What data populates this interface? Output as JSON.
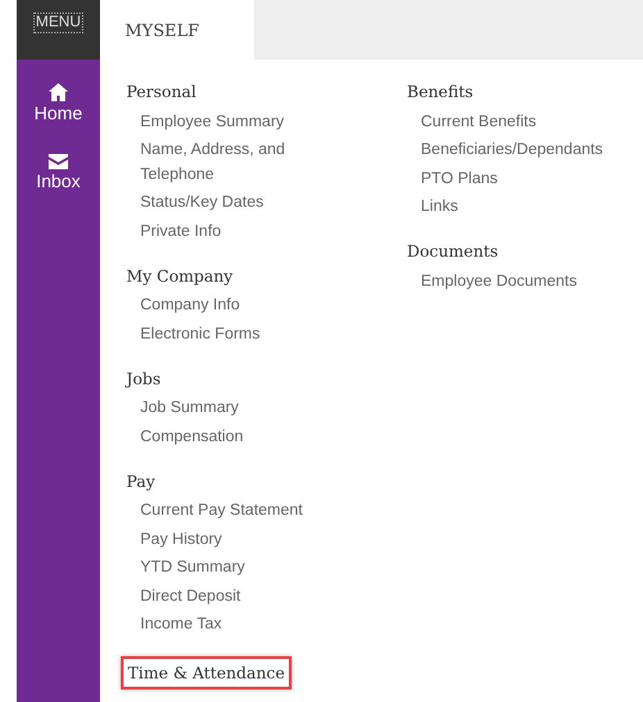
{
  "sidebar": {
    "menu_label": "MENU",
    "items": [
      {
        "label": "Home",
        "kind": "home"
      },
      {
        "label": "Inbox",
        "kind": "inbox"
      }
    ]
  },
  "tabs": [
    {
      "label": "MYSELF",
      "selected": true
    }
  ],
  "columns": [
    [
      {
        "title": "Personal",
        "highlighted": false,
        "items": [
          "Employee Summary",
          "Name, Address, and Telephone",
          "Status/Key Dates",
          "Private Info"
        ]
      },
      {
        "title": "My Company",
        "highlighted": false,
        "items": [
          "Company Info",
          "Electronic Forms"
        ]
      },
      {
        "title": "Jobs",
        "highlighted": false,
        "items": [
          "Job Summary",
          "Compensation"
        ]
      },
      {
        "title": "Pay",
        "highlighted": false,
        "items": [
          "Current Pay Statement",
          "Pay History",
          "YTD Summary",
          "Direct Deposit",
          "Income Tax"
        ]
      },
      {
        "title": "Time & Attendance",
        "highlighted": true
      }
    ],
    [
      {
        "title": "Benefits",
        "highlighted": false,
        "items": [
          "Current Benefits",
          "Beneficiaries/Dependants",
          "PTO Plans",
          "Links"
        ]
      },
      {
        "title": "Documents",
        "highlighted": false,
        "items": [
          "Employee Documents"
        ]
      }
    ]
  ]
}
